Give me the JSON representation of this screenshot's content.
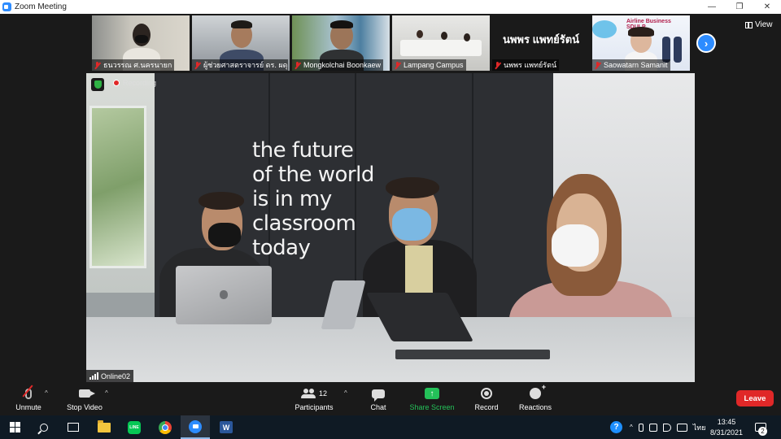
{
  "window": {
    "title": "Zoom Meeting",
    "minimize_glyph": "—",
    "restore_glyph": "❐",
    "close_glyph": "✕"
  },
  "thumbnails": [
    {
      "name": "ธนวรรณ ศ.นครนายก",
      "muted": true
    },
    {
      "name": "ผู้ช่วยศาสตราจารย์ ดร. ผดุง...",
      "muted": true
    },
    {
      "name": "Mongkolchai Boonkaew",
      "muted": true
    },
    {
      "name": "Lampang Campus",
      "muted": true
    },
    {
      "name": "นพพร แพทย์รัตน์",
      "muted": true,
      "display_name": "นพพร แพทย์รัตน์"
    },
    {
      "name": "Saowatarn Samanit",
      "muted": true,
      "banner": "Airline Business SDULP"
    }
  ],
  "view_label": "View",
  "active_speaker": {
    "name": "Online02",
    "recording_label": "Recording",
    "slogan_lines": [
      "the future",
      "of the world",
      "is in my",
      "classroom",
      "today"
    ]
  },
  "toolbar": {
    "unmute": "Unmute",
    "stop_video": "Stop Video",
    "participants": "Participants",
    "participants_count": "12",
    "chat": "Chat",
    "share_screen": "Share Screen",
    "record": "Record",
    "reactions": "Reactions",
    "leave": "Leave",
    "caret": "^"
  },
  "taskbar": {
    "language": "ไทย",
    "time": "13:45",
    "date": "8/31/2021",
    "notifications": "2",
    "word_letter": "W",
    "line_label": "LINE",
    "help_glyph": "?"
  },
  "colors": {
    "accent": "#2d8cff",
    "leave": "#e02828",
    "share": "#24c159"
  }
}
